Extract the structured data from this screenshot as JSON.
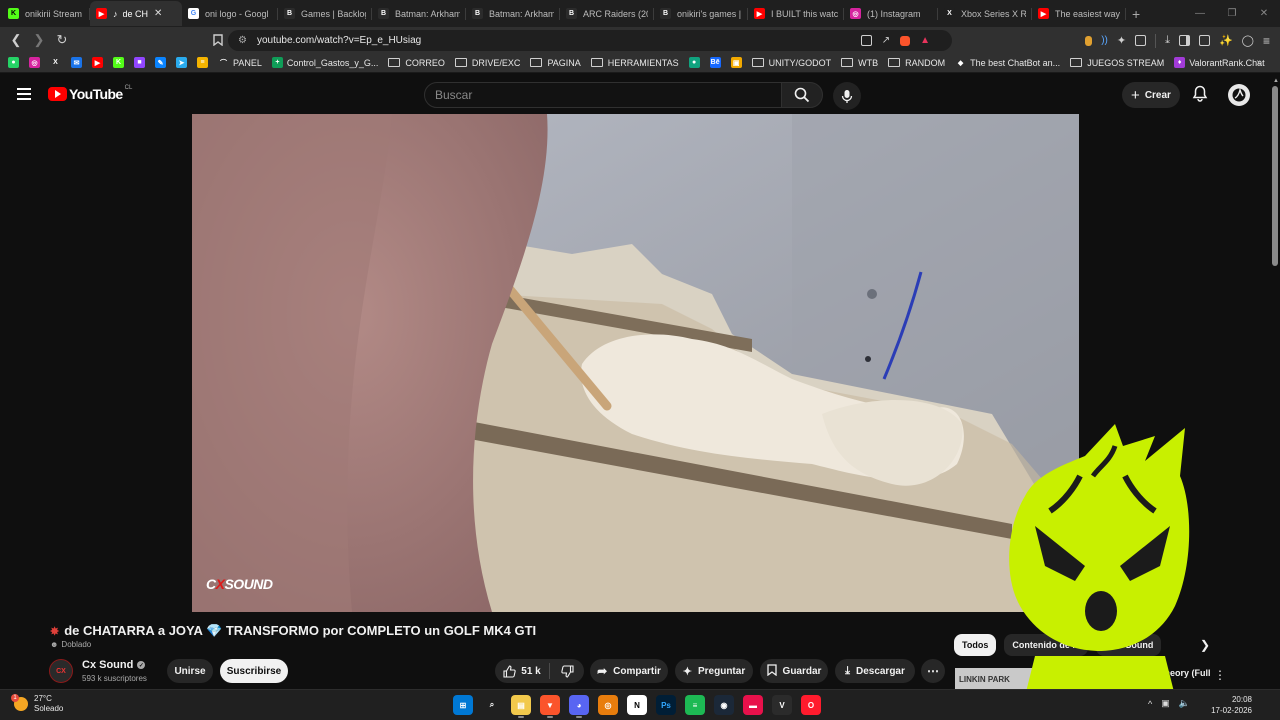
{
  "browser": {
    "tabs": [
      {
        "title": "onikirii Stream - •",
        "favicon_color": "#53fc18",
        "favicon_text": "K",
        "favicon_text_color": "#000"
      },
      {
        "title": "de CH",
        "favicon_color": "#ff0000",
        "favicon_text": "▶",
        "favicon_text_color": "#fff",
        "active": true
      },
      {
        "title": "oni logo - Googl",
        "favicon_color": "#ffffff",
        "favicon_text": "G",
        "favicon_text_color": "#4285f4"
      },
      {
        "title": "Games | Backlog",
        "favicon_color": "#2b2b2b",
        "favicon_text": "B",
        "favicon_text_color": "#fff"
      },
      {
        "title": "Batman: Arkham",
        "favicon_color": "#2b2b2b",
        "favicon_text": "B",
        "favicon_text_color": "#fff"
      },
      {
        "title": "Batman: Arkham",
        "favicon_color": "#2b2b2b",
        "favicon_text": "B",
        "favicon_text_color": "#fff"
      },
      {
        "title": "ARC Raiders (202",
        "favicon_color": "#2b2b2b",
        "favicon_text": "B",
        "favicon_text_color": "#fff"
      },
      {
        "title": "onikiri's games |",
        "favicon_color": "#2b2b2b",
        "favicon_text": "B",
        "favicon_text_color": "#fff"
      },
      {
        "title": "I BUILT this watch",
        "favicon_color": "#ff0000",
        "favicon_text": "▶",
        "favicon_text_color": "#fff"
      },
      {
        "title": "(1) Instagram",
        "favicon_color": "#d6249f",
        "favicon_text": "◎",
        "favicon_text_color": "#fff"
      },
      {
        "title": "Xbox Series X Ru",
        "favicon_color": "#1f1f1f",
        "favicon_text": "X",
        "favicon_text_color": "#fff"
      },
      {
        "title": "The easiest way t",
        "favicon_color": "#ff0000",
        "favicon_text": "▶",
        "favicon_text_color": "#fff"
      }
    ],
    "url": "youtube.com/watch?v=Ep_e_HUsiag",
    "bookmarks": [
      {
        "label": "",
        "icon": "whatsapp",
        "color": "#25d366",
        "glyph": "●"
      },
      {
        "label": "",
        "icon": "instagram",
        "color": "#d6249f",
        "glyph": "◎"
      },
      {
        "label": "",
        "icon": "x",
        "color": "#303030",
        "glyph": "X"
      },
      {
        "label": "",
        "icon": "mail",
        "color": "#1a73e8",
        "glyph": "✉"
      },
      {
        "label": "",
        "icon": "youtube",
        "color": "#ff0000",
        "glyph": "▶"
      },
      {
        "label": "",
        "icon": "kick",
        "color": "#53fc18",
        "glyph": "K"
      },
      {
        "label": "",
        "icon": "twitch",
        "color": "#9146ff",
        "glyph": "■"
      },
      {
        "label": "",
        "icon": "pen",
        "color": "#0a84ff",
        "glyph": "✎"
      },
      {
        "label": "",
        "icon": "telegram",
        "color": "#2aabee",
        "glyph": "➤"
      },
      {
        "label": "",
        "icon": "bar",
        "color": "#f5b400",
        "glyph": "≡"
      },
      {
        "label": "PANEL",
        "icon": "panel",
        "color": "#303030",
        "glyph": "⌒"
      },
      {
        "label": "Control_Gastos_y_G...",
        "icon": "sheets",
        "color": "#0f9d58",
        "glyph": "+"
      },
      {
        "label": "CORREO",
        "icon": "folder",
        "color": "",
        "glyph": ""
      },
      {
        "label": "DRIVE/EXC",
        "icon": "folder",
        "color": "",
        "glyph": ""
      },
      {
        "label": "PAGINA",
        "icon": "folder",
        "color": "",
        "glyph": ""
      },
      {
        "label": "HERRAMIENTAS",
        "icon": "folder",
        "color": "",
        "glyph": ""
      },
      {
        "label": "",
        "icon": "green-dot",
        "color": "#10a37f",
        "glyph": "●"
      },
      {
        "label": "",
        "icon": "behance",
        "color": "#1769ff",
        "glyph": "Bē"
      },
      {
        "label": "",
        "icon": "photo",
        "color": "#f2a900",
        "glyph": "▣"
      },
      {
        "label": "UNITY/GODOT",
        "icon": "folder",
        "color": "",
        "glyph": ""
      },
      {
        "label": "WTB",
        "icon": "folder",
        "color": "",
        "glyph": ""
      },
      {
        "label": "RANDOM",
        "icon": "folder",
        "color": "",
        "glyph": ""
      },
      {
        "label": "The best ChatBot an...",
        "icon": "diamond",
        "color": "#303030",
        "glyph": "◆"
      },
      {
        "label": "JUEGOS STREAM",
        "icon": "folder",
        "color": "",
        "glyph": ""
      },
      {
        "label": "ValorantRank.Chat",
        "icon": "valorant",
        "color": "#a23bd8",
        "glyph": "♦"
      }
    ],
    "more": "»"
  },
  "youtube": {
    "logo_text": "YouTube",
    "logo_region": "CL",
    "search_placeholder": "Buscar",
    "create_label": "Crear",
    "watermark_prefix": "C",
    "watermark_x": "X",
    "watermark_suffix": "SOUND",
    "video_title": "de CHATARRA a JOYA 💎 TRANSFORMO por COMPLETO un GOLF MK4 GTI",
    "dubbed": "Doblado",
    "channel": {
      "name": "Cx Sound",
      "subscribers": "593 k suscriptores",
      "avatar_text": "CX"
    },
    "join_label": "Unirse",
    "subscribe_label": "Suscribirse",
    "likes": "51 k",
    "share_label": "Compartir",
    "ask_label": "Preguntar",
    "save_label": "Guardar",
    "download_label": "Descargar",
    "chips": [
      "Todos",
      "Contenido de la",
      "e Cx Sound"
    ],
    "recommended": {
      "thumb_text": "LINKIN PARK",
      "title": "rid Theory (Full"
    }
  },
  "taskbar": {
    "temperature": "27°C",
    "weather": "Soleado",
    "weather_badge": "1",
    "time": "20:08",
    "date": "17-02-2026",
    "apps": [
      {
        "name": "windows-start",
        "color": "#0078d4",
        "label": "⊞"
      },
      {
        "name": "search",
        "color": "transparent",
        "label": "⌕"
      },
      {
        "name": "file-explorer",
        "color": "#f2c94c",
        "label": "▤"
      },
      {
        "name": "brave",
        "color": "#fb542b",
        "label": "▼"
      },
      {
        "name": "discord",
        "color": "#5865f2",
        "label": "◕"
      },
      {
        "name": "blender",
        "color": "#e87d0d",
        "label": "◎"
      },
      {
        "name": "notion",
        "color": "#ffffff",
        "label": "N"
      },
      {
        "name": "photoshop",
        "color": "#001e36",
        "label": "Ps"
      },
      {
        "name": "spotify",
        "color": "#1db954",
        "label": "≡"
      },
      {
        "name": "steam",
        "color": "#1b2838",
        "label": "◉"
      },
      {
        "name": "game-app",
        "color": "#e8114b",
        "label": "▬"
      },
      {
        "name": "valorant",
        "color": "#2b2b2b",
        "label": "V"
      },
      {
        "name": "opera",
        "color": "#ff1b2d",
        "label": "O"
      }
    ]
  }
}
